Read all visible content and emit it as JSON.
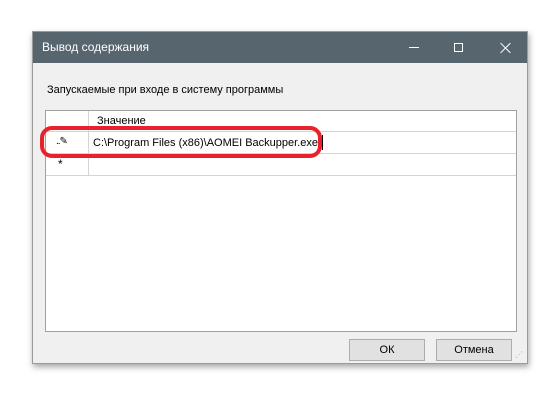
{
  "window": {
    "title": "Вывод содержания"
  },
  "caption": "Запускаемые при входе в систему программы",
  "grid": {
    "column_header": "Значение",
    "rows": [
      {
        "marker": "..✎",
        "value": "C:\\Program Files (x86)\\AOMEI Backupper.exe"
      },
      {
        "marker": "*",
        "value": ""
      }
    ]
  },
  "buttons": {
    "ok": "ОК",
    "cancel": "Отмена"
  },
  "colors": {
    "titlebar": "#57656f",
    "highlight": "#e8222a"
  }
}
